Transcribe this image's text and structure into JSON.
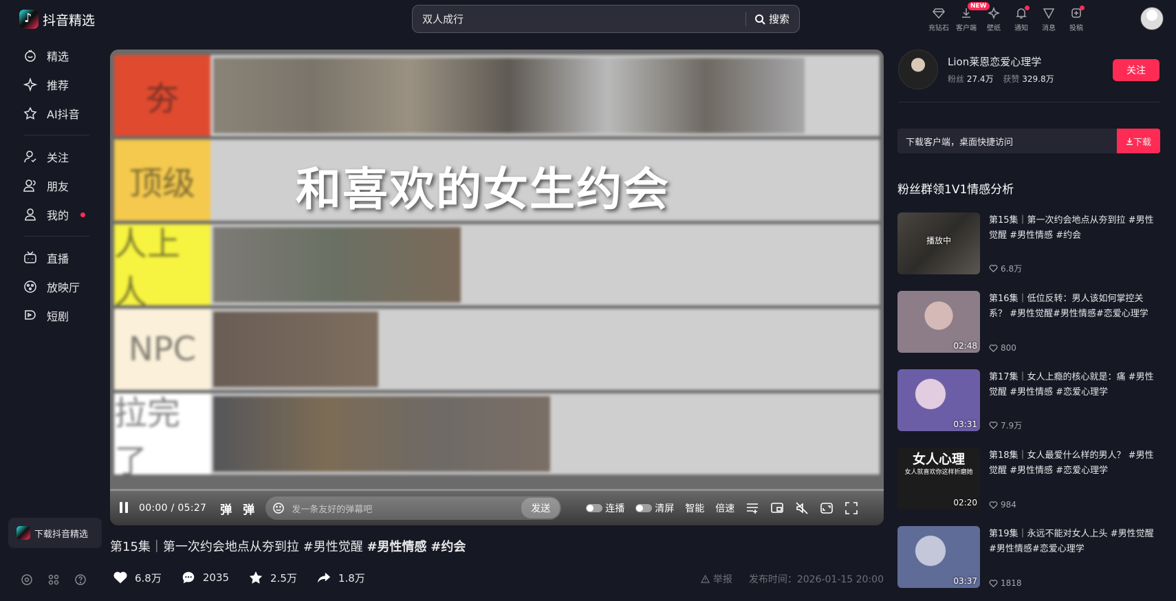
{
  "app": {
    "name": "抖音精选"
  },
  "search": {
    "value": "双人成行",
    "button_label": "搜索"
  },
  "top_icons": [
    {
      "icon": "diamond-icon",
      "label": "充钻石"
    },
    {
      "icon": "download-icon",
      "label": "客户端",
      "badge": "NEW"
    },
    {
      "icon": "wallpaper-icon",
      "label": "壁纸"
    },
    {
      "icon": "bell-icon",
      "label": "通知",
      "dot": true
    },
    {
      "icon": "message-icon",
      "label": "消息"
    },
    {
      "icon": "upload-icon",
      "label": "投稿",
      "dot": true
    }
  ],
  "sidebar": {
    "groups": [
      [
        {
          "icon": "featured-icon",
          "label": "精选"
        },
        {
          "icon": "sparkle-icon",
          "label": "推荐"
        },
        {
          "icon": "ai-icon",
          "label": "AI抖音"
        }
      ],
      [
        {
          "icon": "follow-icon",
          "label": "关注"
        },
        {
          "icon": "friends-icon",
          "label": "朋友"
        },
        {
          "icon": "user-icon",
          "label": "我的",
          "dot": true
        }
      ],
      [
        {
          "icon": "tv-icon",
          "label": "直播"
        },
        {
          "icon": "cinema-icon",
          "label": "放映厅"
        },
        {
          "icon": "short-drama-icon",
          "label": "短剧"
        }
      ]
    ],
    "download_label": "下载抖音精选"
  },
  "video": {
    "overlay_text": "和喜欢的女生约会",
    "tier_labels": [
      "夯",
      "顶级",
      "人上人",
      "NPC",
      "拉完了"
    ],
    "tier_colors": [
      "#e04a2f",
      "#f4c94d",
      "#f6f341",
      "#fbf1da",
      "#ffffff"
    ],
    "time_current": "00:00",
    "time_separator": "/",
    "time_total": "05:27",
    "danmu_on_label": "弹",
    "danmu_settings_label": "弹",
    "danmu_placeholder": "发一条友好的弹幕吧",
    "send_label": "发送",
    "autoplay_label": "连播",
    "clear_label": "清屏",
    "quality_label": "智能",
    "speed_label": "倍速",
    "title_prefix": "第15集｜第一次约会地点从夯到拉 #男性觉醒 ",
    "title_tag1": "#男性情感",
    "title_tag2": "#约会",
    "likes": "6.8万",
    "comments": "2035",
    "favorites": "2.5万",
    "shares": "1.8万",
    "report_label": "举报",
    "publish_time": "发布时间：2026-01-15 20:00"
  },
  "author": {
    "name": "Lion莱恩恋爱心理学",
    "fans_label": "粉丝",
    "fans": "27.4万",
    "likes_label": "获赞",
    "likes": "329.8万",
    "follow_label": "关注"
  },
  "download_banner": {
    "text": "下载客户端，桌面快捷访问",
    "button": "下载"
  },
  "playlist": {
    "title": "粉丝群领1V1情感分析",
    "items": [
      {
        "title": "第15集｜第一次约会地点从夯到拉 #男性觉醒 #男性情感 #约会",
        "likes": "6.8万",
        "duration": "",
        "playing_label": "播放中",
        "thumb_color": "#3a3a3a"
      },
      {
        "title": "第16集｜低位反转：男人该如何掌控关系？ #男性觉醒#男性情感#恋爱心理学",
        "likes": "800",
        "duration": "02:48",
        "thumb_color": "#8c7d88"
      },
      {
        "title": "第17集｜女人上瘾的核心就是：痛 #男性觉醒 #男性情感 #恋爱心理学",
        "likes": "7.9万",
        "duration": "03:31",
        "thumb_color": "#6c5ea6"
      },
      {
        "title": "第18集｜女人最爱什么样的男人？ #男性觉醒 #男性情感 #恋爱心理学",
        "likes": "984",
        "duration": "02:20",
        "thumb_color": "#1c1c1c",
        "thumb_text": "女人心理",
        "thumb_sub": "女人就喜欢你这样折磨她"
      },
      {
        "title": "第19集｜永远不能对女人上头 #男性觉醒#男性情感#恋爱心理学",
        "likes": "1818",
        "duration": "03:37",
        "thumb_color": "#5f6c98"
      }
    ]
  }
}
